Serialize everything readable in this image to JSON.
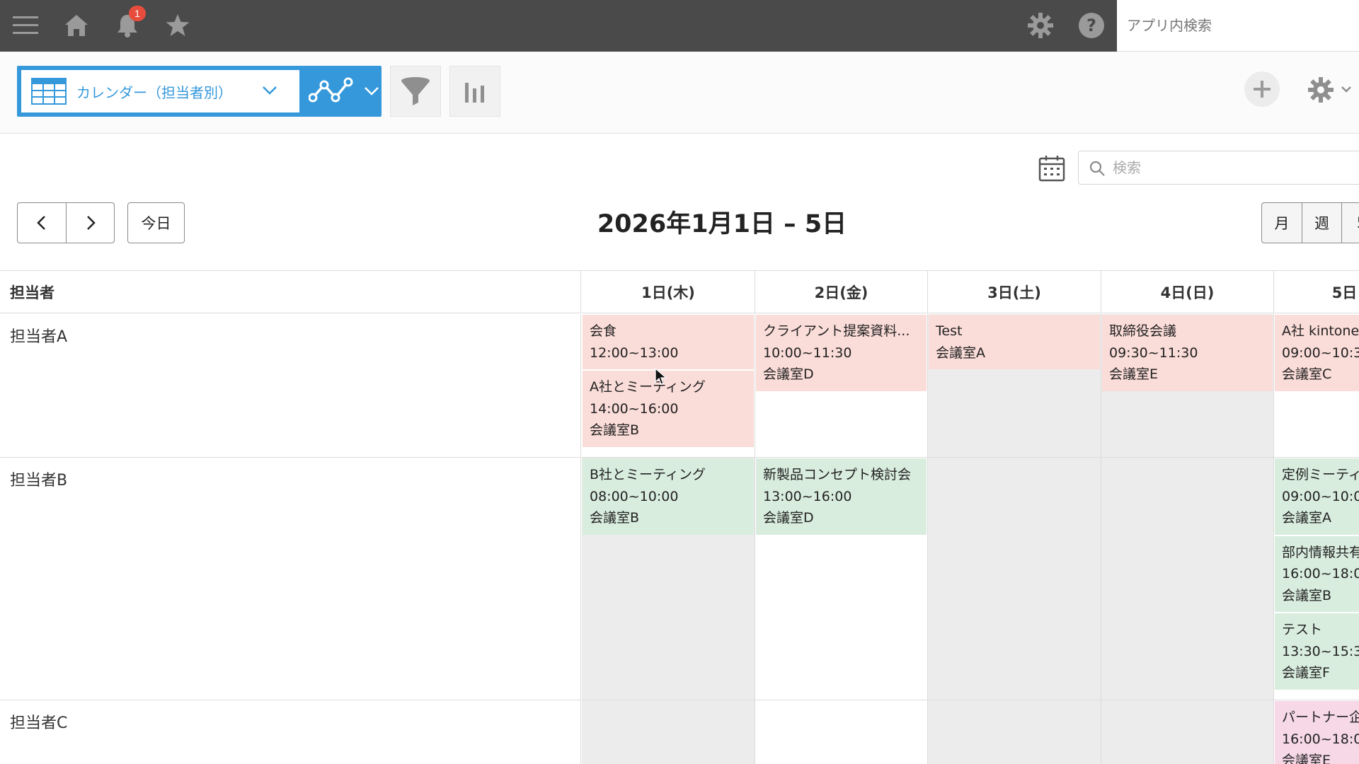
{
  "header": {
    "notification_count": "1",
    "app_search_placeholder": "アプリ内検索",
    "icons": [
      "menu-icon",
      "home-icon",
      "bell-icon",
      "star-icon",
      "gear-icon",
      "help-icon"
    ]
  },
  "toolbar": {
    "view_label": "カレンダー（担当者別）",
    "accent_color": "#3498db"
  },
  "calendar": {
    "search_placeholder": "検索",
    "today_label": "今日",
    "title": "2026年1月1日 – 5日",
    "view_month": "月",
    "view_week": "週",
    "view_5day": "5"
  },
  "grid": {
    "assignee_header": "担当者",
    "days": [
      "1日(木)",
      "2日(金)",
      "3日(土)",
      "4日(日)",
      "5日"
    ],
    "rows": [
      {
        "label": "担当者A",
        "events": [
          [
            {
              "title": "会食",
              "time": "12:00~13:00",
              "room": "",
              "color": "red"
            },
            {
              "title": "A社とミーティング",
              "time": "14:00~16:00",
              "room": "会議室B",
              "color": "red"
            }
          ],
          [
            {
              "title": "クライアント提案資料...",
              "time": "10:00~11:30",
              "room": "会議室D",
              "color": "red"
            }
          ],
          [
            {
              "title": "Test",
              "time": "会議室A",
              "room": "",
              "color": "red"
            }
          ],
          [
            {
              "title": "取締役会議",
              "time": "09:30~11:30",
              "room": "会議室E",
              "color": "red"
            }
          ],
          [
            {
              "title": "A社 kintone",
              "time": "09:00~10:3",
              "room": "会議室C",
              "color": "red"
            }
          ]
        ]
      },
      {
        "label": "担当者B",
        "events": [
          [
            {
              "title": "B社とミーティング",
              "time": "08:00~10:00",
              "room": "会議室B",
              "color": "green"
            }
          ],
          [
            {
              "title": "新製品コンセプト検討会",
              "time": "13:00~16:00",
              "room": "会議室D",
              "color": "green"
            }
          ],
          [],
          [],
          [
            {
              "title": "定例ミーティ",
              "time": "09:00~10:0",
              "room": "会議室A",
              "color": "green"
            },
            {
              "title": "部内情報共有",
              "time": "16:00~18:0",
              "room": "会議室B",
              "color": "green"
            },
            {
              "title": "テスト",
              "time": "13:30~15:3",
              "room": "会議室F",
              "color": "green"
            }
          ]
        ]
      },
      {
        "label": "担当者C",
        "events": [
          [],
          [],
          [],
          [],
          [
            {
              "title": "パートナー企",
              "time": "16:00~18:0",
              "room": "会議室E",
              "color": "pink"
            }
          ]
        ]
      }
    ]
  }
}
